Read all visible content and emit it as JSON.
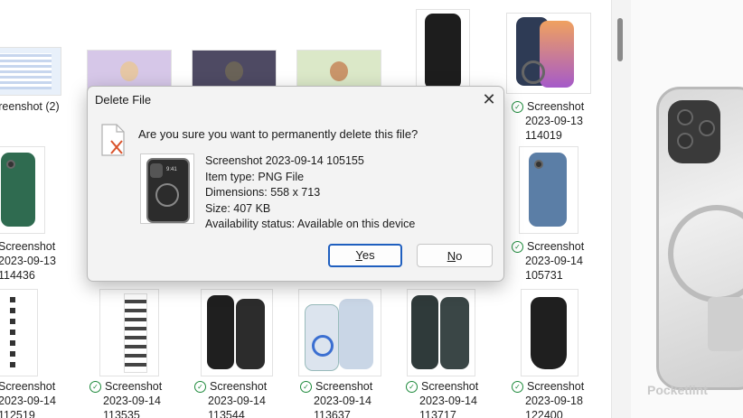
{
  "dialog": {
    "title": "Delete File",
    "question": "Are you sure you want to permanently delete this file?",
    "file_name": "Screenshot 2023-09-14 105155",
    "item_type": "Item type: PNG File",
    "dimensions": "Dimensions: 558 x 713",
    "size": "Size: 407 KB",
    "availability": "Availability status: Available on this device",
    "yes_letter": "Y",
    "yes_rest": "es",
    "no_letter": "N",
    "no_rest": "o"
  },
  "tiles": [
    {
      "line1": "creenshot (2)",
      "line2": "",
      "line3": "",
      "checked": false
    },
    {
      "line1": "Screenshot",
      "line2": "2023-09-13",
      "line3": "114019",
      "checked": true
    },
    {
      "line1": "Screenshot",
      "line2": "2023-09-13",
      "line3": "114436",
      "checked": false
    },
    {
      "line1": "Screenshot",
      "line2": "2023-09-14",
      "line3": "105731",
      "checked": true
    },
    {
      "line1": "Screenshot",
      "line2": "2023-09-14",
      "line3": "112519",
      "checked": false
    },
    {
      "line1": "Screenshot",
      "line2": "2023-09-14",
      "line3": "113535",
      "checked": true
    },
    {
      "line1": "Screenshot",
      "line2": "2023-09-14",
      "line3": "113544",
      "checked": true
    },
    {
      "line1": "Screenshot",
      "line2": "2023-09-14",
      "line3": "113637",
      "checked": true
    },
    {
      "line1": "Screenshot",
      "line2": "2023-09-14",
      "line3": "113717",
      "checked": true
    },
    {
      "line1": "Screenshot",
      "line2": "2023-09-18",
      "line3": "122400",
      "checked": true
    }
  ],
  "phone_preview": {
    "time": "9:41"
  },
  "watermark": "Pocketlint"
}
